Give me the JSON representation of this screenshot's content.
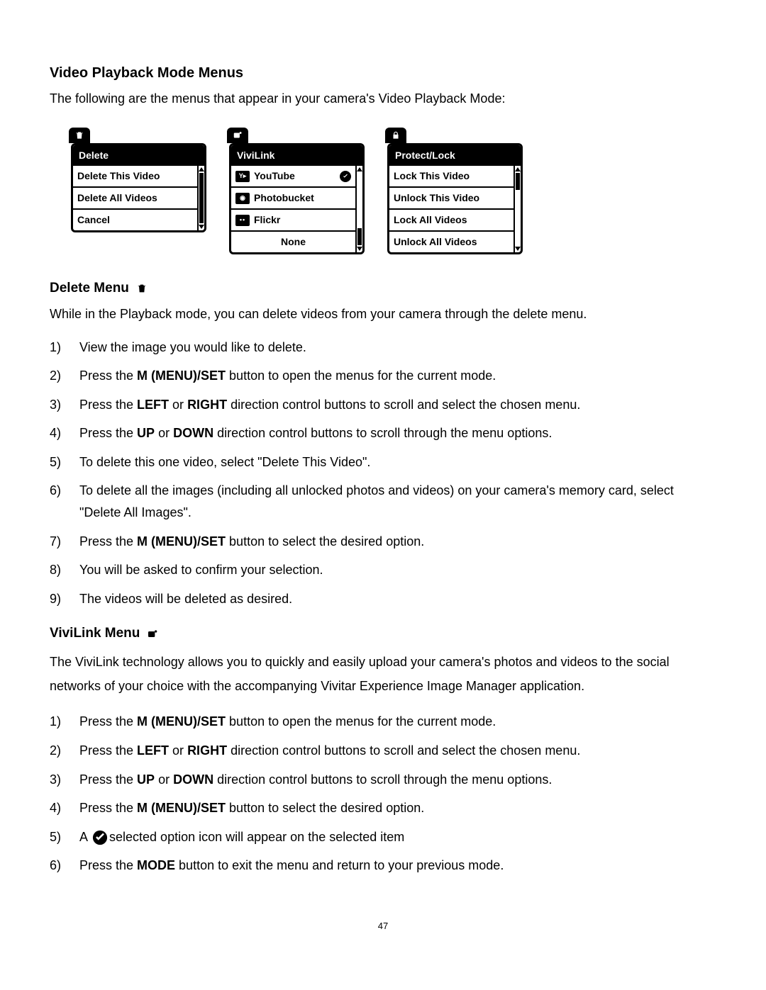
{
  "headings": {
    "main": "Video Playback Mode Menus",
    "delete": "Delete Menu",
    "vivilink": "ViviLink Menu"
  },
  "intro": "The following are the menus that appear in your camera's Video Playback Mode:",
  "menus": {
    "delete": {
      "title": "Delete",
      "items": [
        "Delete This Video",
        "Delete All Videos",
        "Cancel"
      ]
    },
    "vivilink": {
      "title": "ViviLink",
      "items": [
        "YouTube",
        "Photobucket",
        "Flickr",
        "None"
      ]
    },
    "protect": {
      "title": "Protect/Lock",
      "items": [
        "Lock This Video",
        "Unlock This Video",
        "Lock All Videos",
        "Unlock All Videos"
      ]
    }
  },
  "delete_intro": "While in the Playback mode, you can delete videos from your camera through the delete menu.",
  "delete_steps": [
    [
      {
        "t": "View the image you would like to delete."
      }
    ],
    [
      {
        "t": "Press the "
      },
      {
        "b": "M (MENU)/SET"
      },
      {
        "t": " button to open the menus for the current mode."
      }
    ],
    [
      {
        "t": "Press the "
      },
      {
        "b": "LEFT"
      },
      {
        "t": " or "
      },
      {
        "b": "RIGHT"
      },
      {
        "t": " direction control buttons to scroll and select the chosen menu."
      }
    ],
    [
      {
        "t": "Press the "
      },
      {
        "b": "UP"
      },
      {
        "t": " or "
      },
      {
        "b": "DOWN"
      },
      {
        "t": " direction control buttons to scroll through the menu options."
      }
    ],
    [
      {
        "t": "To delete this one video, select \"Delete This Video\"."
      }
    ],
    [
      {
        "t": "To delete all the images (including all unlocked photos and videos) on your camera's memory card, select \"Delete All Images\"."
      }
    ],
    [
      {
        "t": "Press the "
      },
      {
        "b": "M (MENU)/SET"
      },
      {
        "t": " button to select the desired option."
      }
    ],
    [
      {
        "t": "You will be asked to confirm your selection."
      }
    ],
    [
      {
        "t": "The videos will be deleted as desired."
      }
    ]
  ],
  "vivilink_intro": "The ViviLink technology allows you to quickly and easily upload your camera's photos and videos to the social networks of your choice with the accompanying Vivitar Experience Image Manager application.",
  "vivilink_steps": [
    [
      {
        "t": "Press the "
      },
      {
        "b": "M (MENU)/SET"
      },
      {
        "t": " button to open the menus for the current mode."
      }
    ],
    [
      {
        "t": "Press the "
      },
      {
        "b": "LEFT"
      },
      {
        "t": " or "
      },
      {
        "b": "RIGHT"
      },
      {
        "t": " direction control buttons to scroll and select the chosen menu."
      }
    ],
    [
      {
        "t": "Press the "
      },
      {
        "b": "UP"
      },
      {
        "t": " or "
      },
      {
        "b": "DOWN"
      },
      {
        "t": " direction control buttons to scroll through the menu options."
      }
    ],
    [
      {
        "t": "Press the "
      },
      {
        "b": "M (MENU)/SET"
      },
      {
        "t": " button to select the desired option."
      }
    ],
    [
      {
        "t": "A "
      },
      {
        "icon": "check"
      },
      {
        "t": "selected option icon will appear on the selected item"
      }
    ],
    [
      {
        "t": "Press the "
      },
      {
        "b": "MODE"
      },
      {
        "t": " button to exit the menu and return to your previous mode."
      }
    ]
  ],
  "page_number": "47"
}
